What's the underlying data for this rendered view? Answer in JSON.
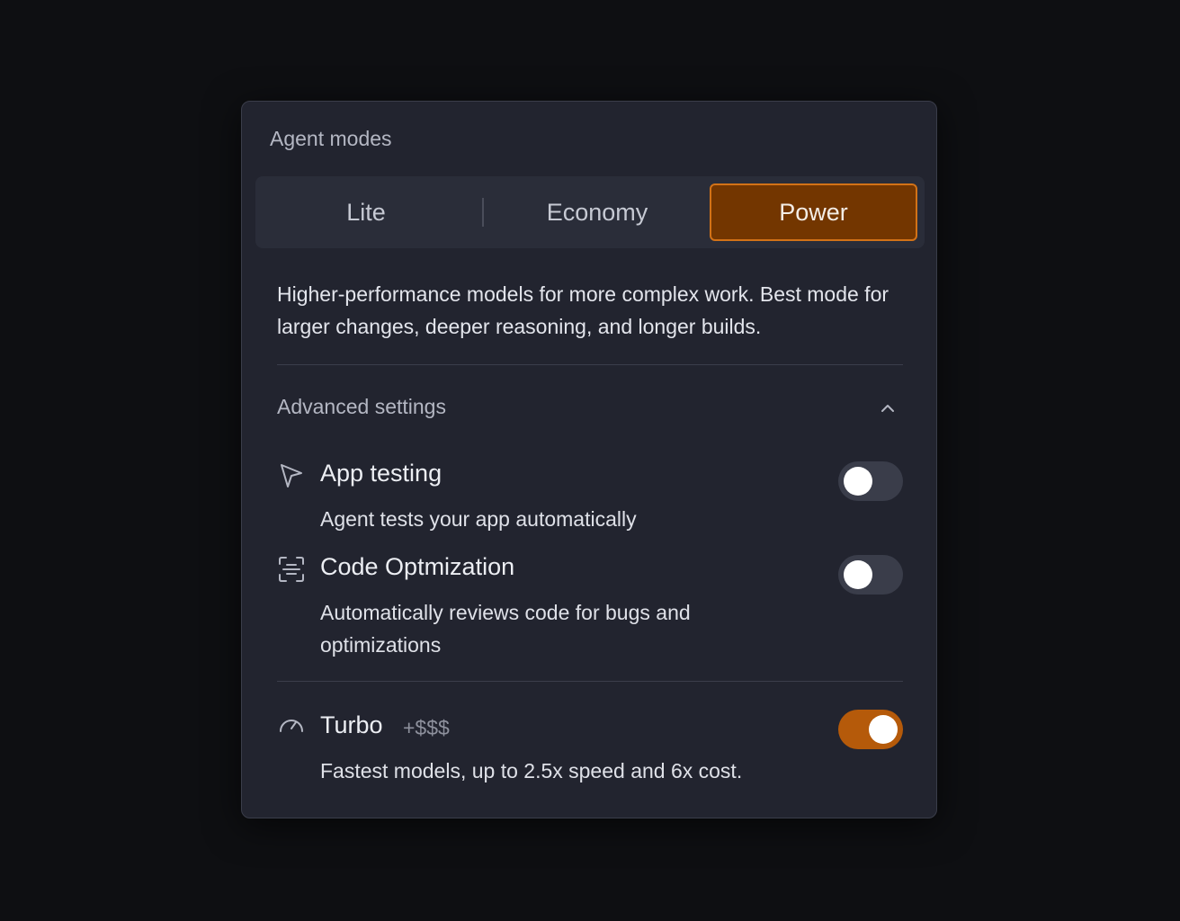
{
  "panel": {
    "title": "Agent modes"
  },
  "modes": {
    "options": [
      {
        "label": "Lite",
        "selected": false
      },
      {
        "label": "Economy",
        "selected": false
      },
      {
        "label": "Power",
        "selected": true
      }
    ],
    "selected_description": "Higher-performance models for more complex work. Best mode for larger changes, deeper reasoning, and longer builds."
  },
  "advanced": {
    "label": "Advanced settings",
    "expanded": true,
    "chevron_icon": "chevron-up-icon",
    "settings": [
      {
        "icon": "cursor-pointer-icon",
        "title": "App testing",
        "description": "Agent tests your app automatically",
        "enabled": false
      },
      {
        "icon": "code-scan-icon",
        "title": "Code Optmization",
        "description": "Automatically reviews code for bugs and optimizations",
        "enabled": false
      }
    ]
  },
  "turbo": {
    "icon": "speedometer-icon",
    "title": "Turbo",
    "cost_badge": "+$$$",
    "description": "Fastest models, up to 2.5x speed and 6x cost.",
    "enabled": true
  },
  "colors": {
    "accent": "#d27217",
    "accent_fill": "#733600",
    "toggle_on": "#b55a0a",
    "panel_bg": "#22242f",
    "page_bg": "#0e0f12"
  }
}
